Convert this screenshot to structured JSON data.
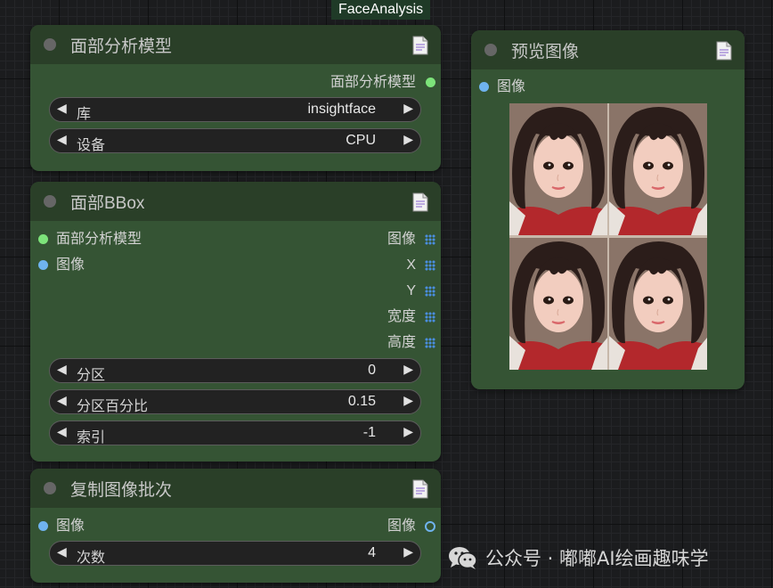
{
  "group": {
    "label": "FaceAnalysis"
  },
  "face_model_node": {
    "title": "面部分析模型",
    "output_label": "面部分析模型",
    "widgets": [
      {
        "label": "库",
        "value": "insightface"
      },
      {
        "label": "设备",
        "value": "CPU"
      }
    ]
  },
  "bbox_node": {
    "title": "面部BBox",
    "inputs": [
      "面部分析模型",
      "图像"
    ],
    "outputs": [
      "图像",
      "X",
      "Y",
      "宽度",
      "高度"
    ],
    "widgets": [
      {
        "label": "分区",
        "value": "0"
      },
      {
        "label": "分区百分比",
        "value": "0.15"
      },
      {
        "label": "索引",
        "value": "-1"
      }
    ]
  },
  "batch_node": {
    "title": "复制图像批次",
    "input_label": "图像",
    "output_label": "图像",
    "widgets": [
      {
        "label": "次数",
        "value": "4"
      }
    ]
  },
  "preview_node": {
    "title": "预览图像",
    "input_label": "图像",
    "image_tiles": 4
  },
  "watermark": {
    "text": "公众号 · 嘟嘟AI绘画趣味学"
  },
  "colors": {
    "node_body": "#355434",
    "node_header": "#2a3f28",
    "pin_model": "#7de37a",
    "pin_image": "#6fb3ee",
    "pin_int": "#4a8ee0",
    "canvas": "#1b1c1e"
  },
  "icons": {
    "header_doc": "document-icon",
    "widget_dec": "triangle-left-icon",
    "widget_inc": "triangle-right-icon",
    "watermark": "wechat-icon"
  }
}
